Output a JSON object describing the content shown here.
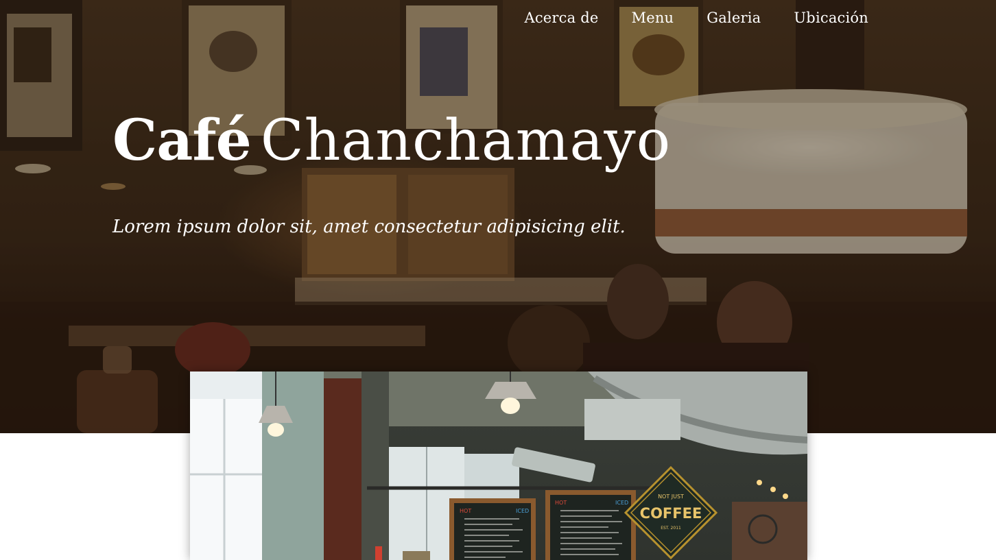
{
  "nav": {
    "items": [
      {
        "label": "Acerca de"
      },
      {
        "label": "Menu"
      },
      {
        "label": "Galeria"
      },
      {
        "label": "Ubicación"
      }
    ]
  },
  "hero": {
    "title_bold": "Café",
    "title_light": "Chanchamayo",
    "tagline": "Lorem ipsum dolor sit, amet consectetur adipisicing elit."
  },
  "feature_image": {
    "sign_top": "NOT JUST",
    "sign_main": "COFFEE",
    "sign_bottom": "EST. 2011",
    "board_left_hot": "HOT",
    "board_left_iced": "ICED",
    "board_right_hot": "HOT",
    "board_right_iced": "ICED"
  }
}
